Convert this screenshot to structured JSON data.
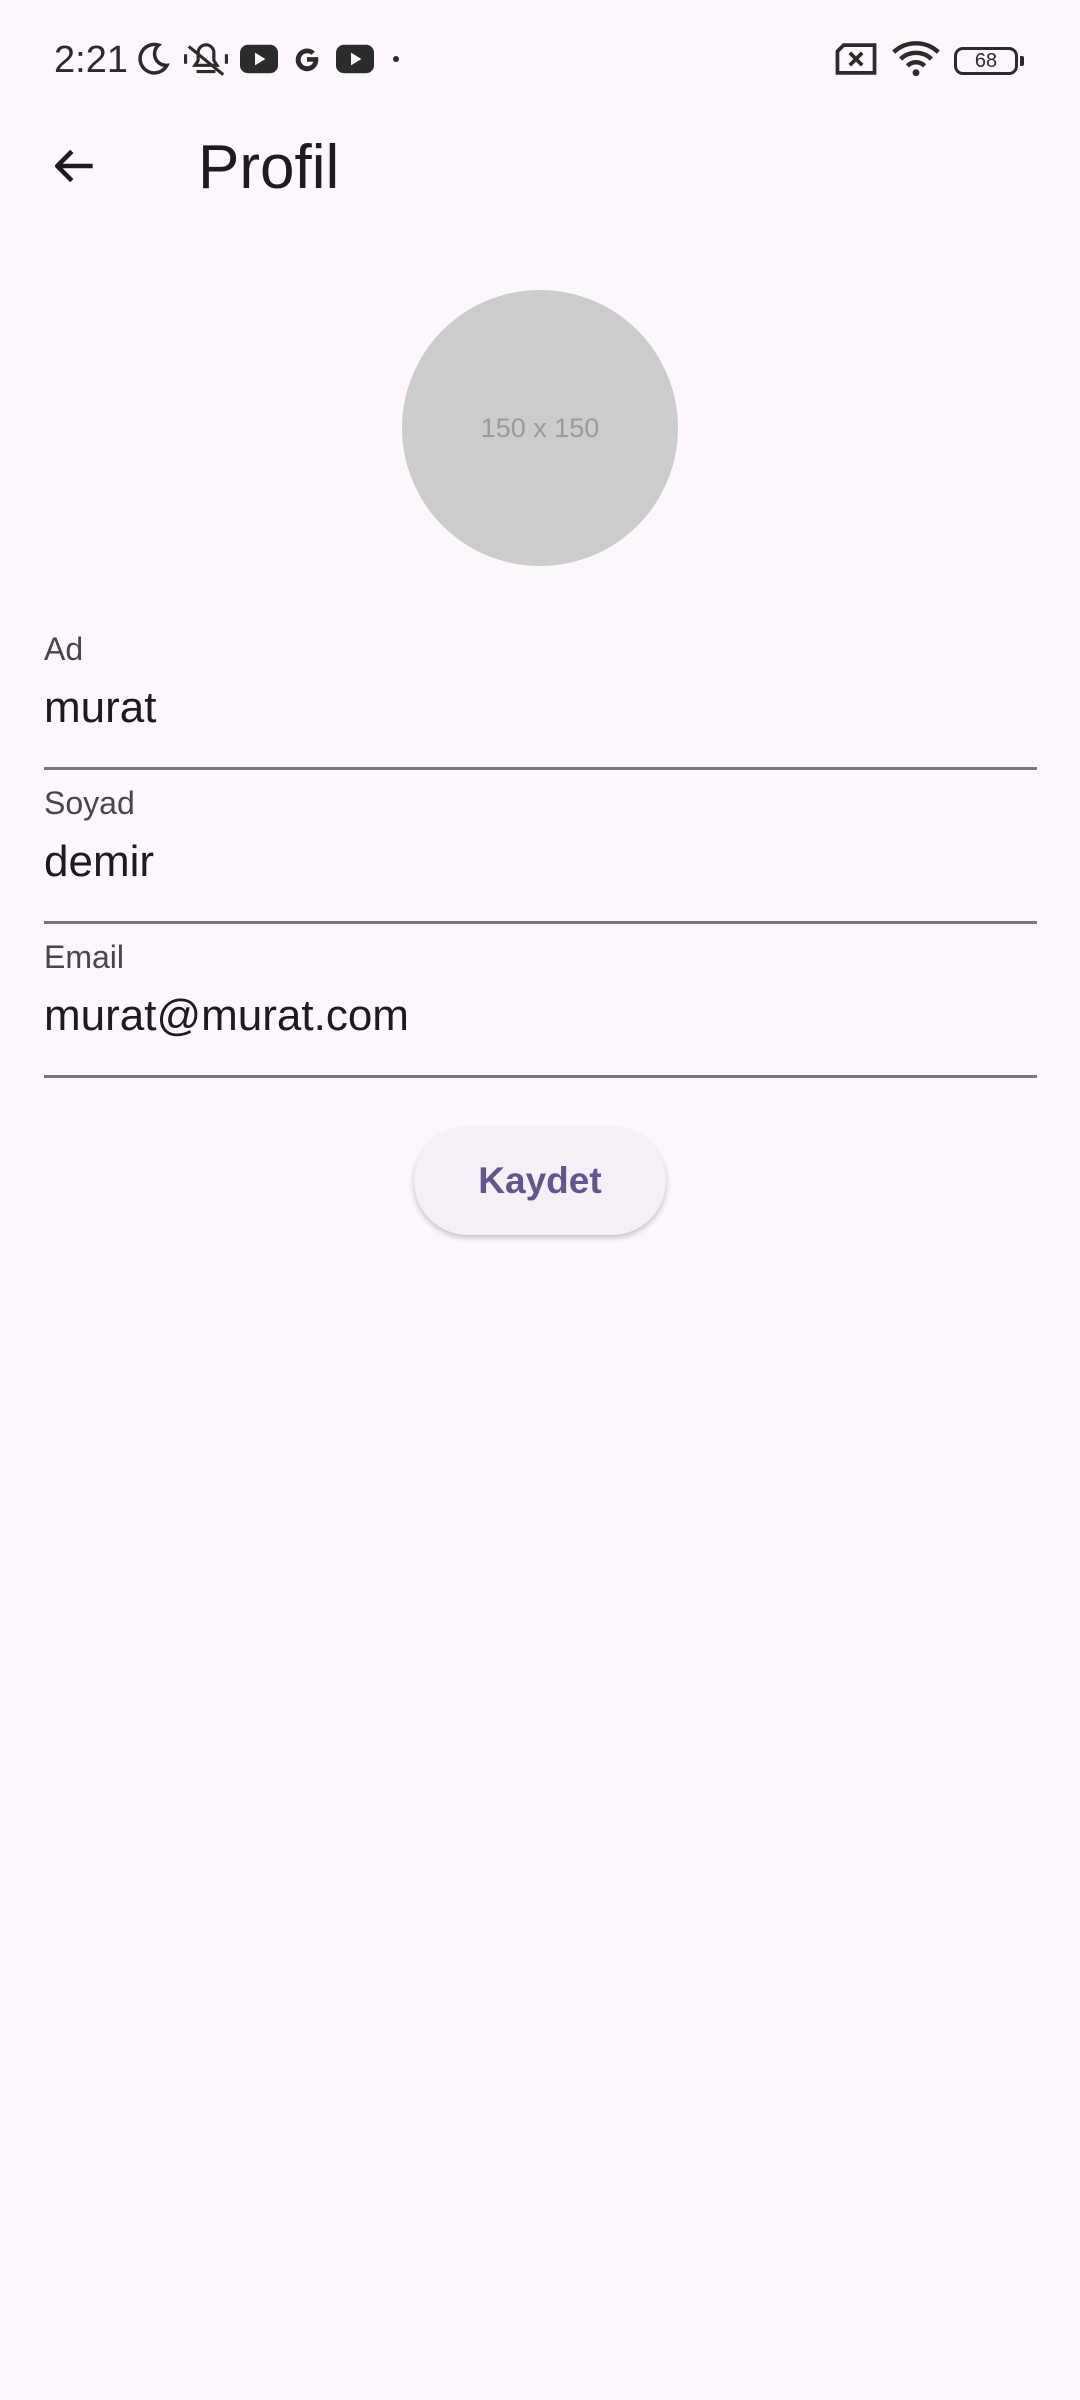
{
  "status_bar": {
    "time": "2:21",
    "battery_level": "68",
    "left_icons": [
      "moon-icon",
      "vibrate-off-icon",
      "youtube-icon",
      "google-icon",
      "youtube-icon",
      "dot-icon"
    ],
    "right_icons": [
      "sim-off-icon",
      "wifi-icon",
      "battery-icon"
    ]
  },
  "app_bar": {
    "title": "Profil",
    "back_icon": "arrow-left-icon"
  },
  "avatar": {
    "placeholder_text": "150 x 150"
  },
  "form": {
    "first_name": {
      "label": "Ad",
      "value": "murat"
    },
    "last_name": {
      "label": "Soyad",
      "value": "demir"
    },
    "email": {
      "label": "Email",
      "value": "murat@murat.com"
    }
  },
  "actions": {
    "save_label": "Kaydet"
  },
  "colors": {
    "background": "#fdf7fd",
    "accent": "#65558f",
    "button_bg": "#f5eff7",
    "underline": "#79747e",
    "avatar_bg": "#cccccc"
  }
}
